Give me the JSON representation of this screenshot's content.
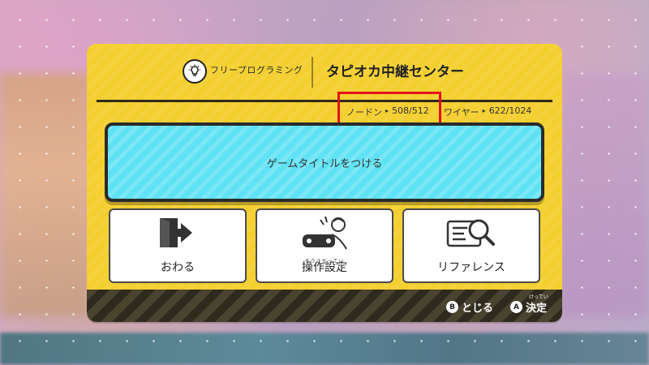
{
  "header": {
    "mode_label": "フリープログラミング",
    "game_title": "タピオカ中継センター"
  },
  "counters": {
    "node_label": "ノードン",
    "node_value": "508/512",
    "wire_label": "ワイヤー",
    "wire_value": "622/1024",
    "arrow": "▸"
  },
  "title_button": {
    "label": "ゲームタイトルをつける"
  },
  "options": {
    "quit": {
      "label": "おわる"
    },
    "controls": {
      "label": "操作設定",
      "ruby": "そうさせってい"
    },
    "reference": {
      "label": "リファレンス"
    }
  },
  "footer": {
    "close_glyph": "B",
    "close_label": "とじる",
    "confirm_glyph": "A",
    "confirm_label": "決定",
    "confirm_ruby": "けってい"
  },
  "colors": {
    "panel": "#f4cf2f",
    "title_button": "#5ee2f4",
    "highlight": "#e3101a"
  }
}
